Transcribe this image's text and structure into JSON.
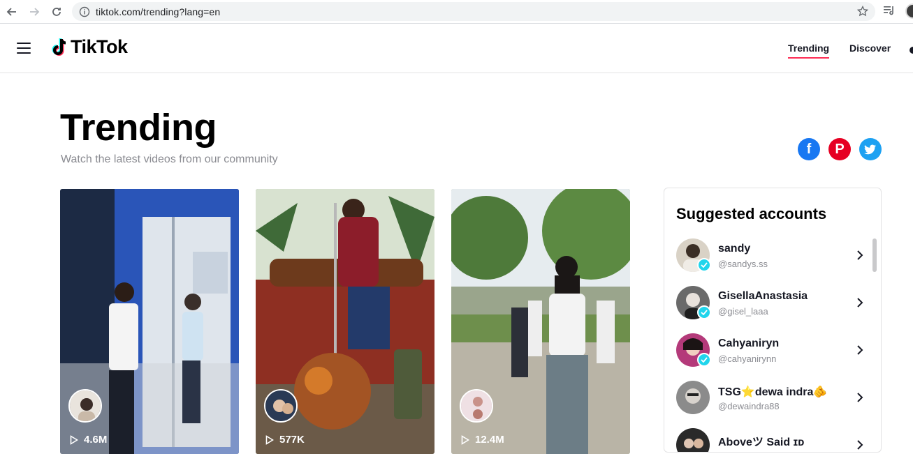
{
  "browser": {
    "url": "tiktok.com/trending?lang=en"
  },
  "header": {
    "logo_text": "TikTok",
    "nav": [
      {
        "label": "Trending",
        "active": true
      },
      {
        "label": "Discover",
        "active": false
      }
    ]
  },
  "hero": {
    "title": "Trending",
    "subtitle": "Watch the latest videos from our community"
  },
  "share": [
    {
      "icon": "facebook-icon",
      "color": "#1877f2"
    },
    {
      "icon": "pinterest-icon",
      "color": "#e60023"
    },
    {
      "icon": "twitter-icon",
      "color": "#1da1f2"
    }
  ],
  "videos": [
    {
      "views": "4.6M"
    },
    {
      "views": "577K"
    },
    {
      "views": "12.4M"
    }
  ],
  "suggested": {
    "title": "Suggested accounts",
    "accounts": [
      {
        "name": "sandy",
        "handle": "@sandys.ss",
        "verified": true
      },
      {
        "name": "GisellaAnastasia",
        "handle": "@gisel_laaa",
        "verified": true
      },
      {
        "name": "Cahyaniryn",
        "handle": "@cahyanirynn",
        "verified": true
      },
      {
        "name": "TSG⭐dewa indra🫵",
        "handle": "@dewaindra88",
        "verified": false
      },
      {
        "name": "Aboveツ Said ɪᴅ",
        "handle": "",
        "verified": false
      }
    ]
  },
  "colors": {
    "accent": "#fe2c55",
    "verified": "#20d5ec"
  }
}
